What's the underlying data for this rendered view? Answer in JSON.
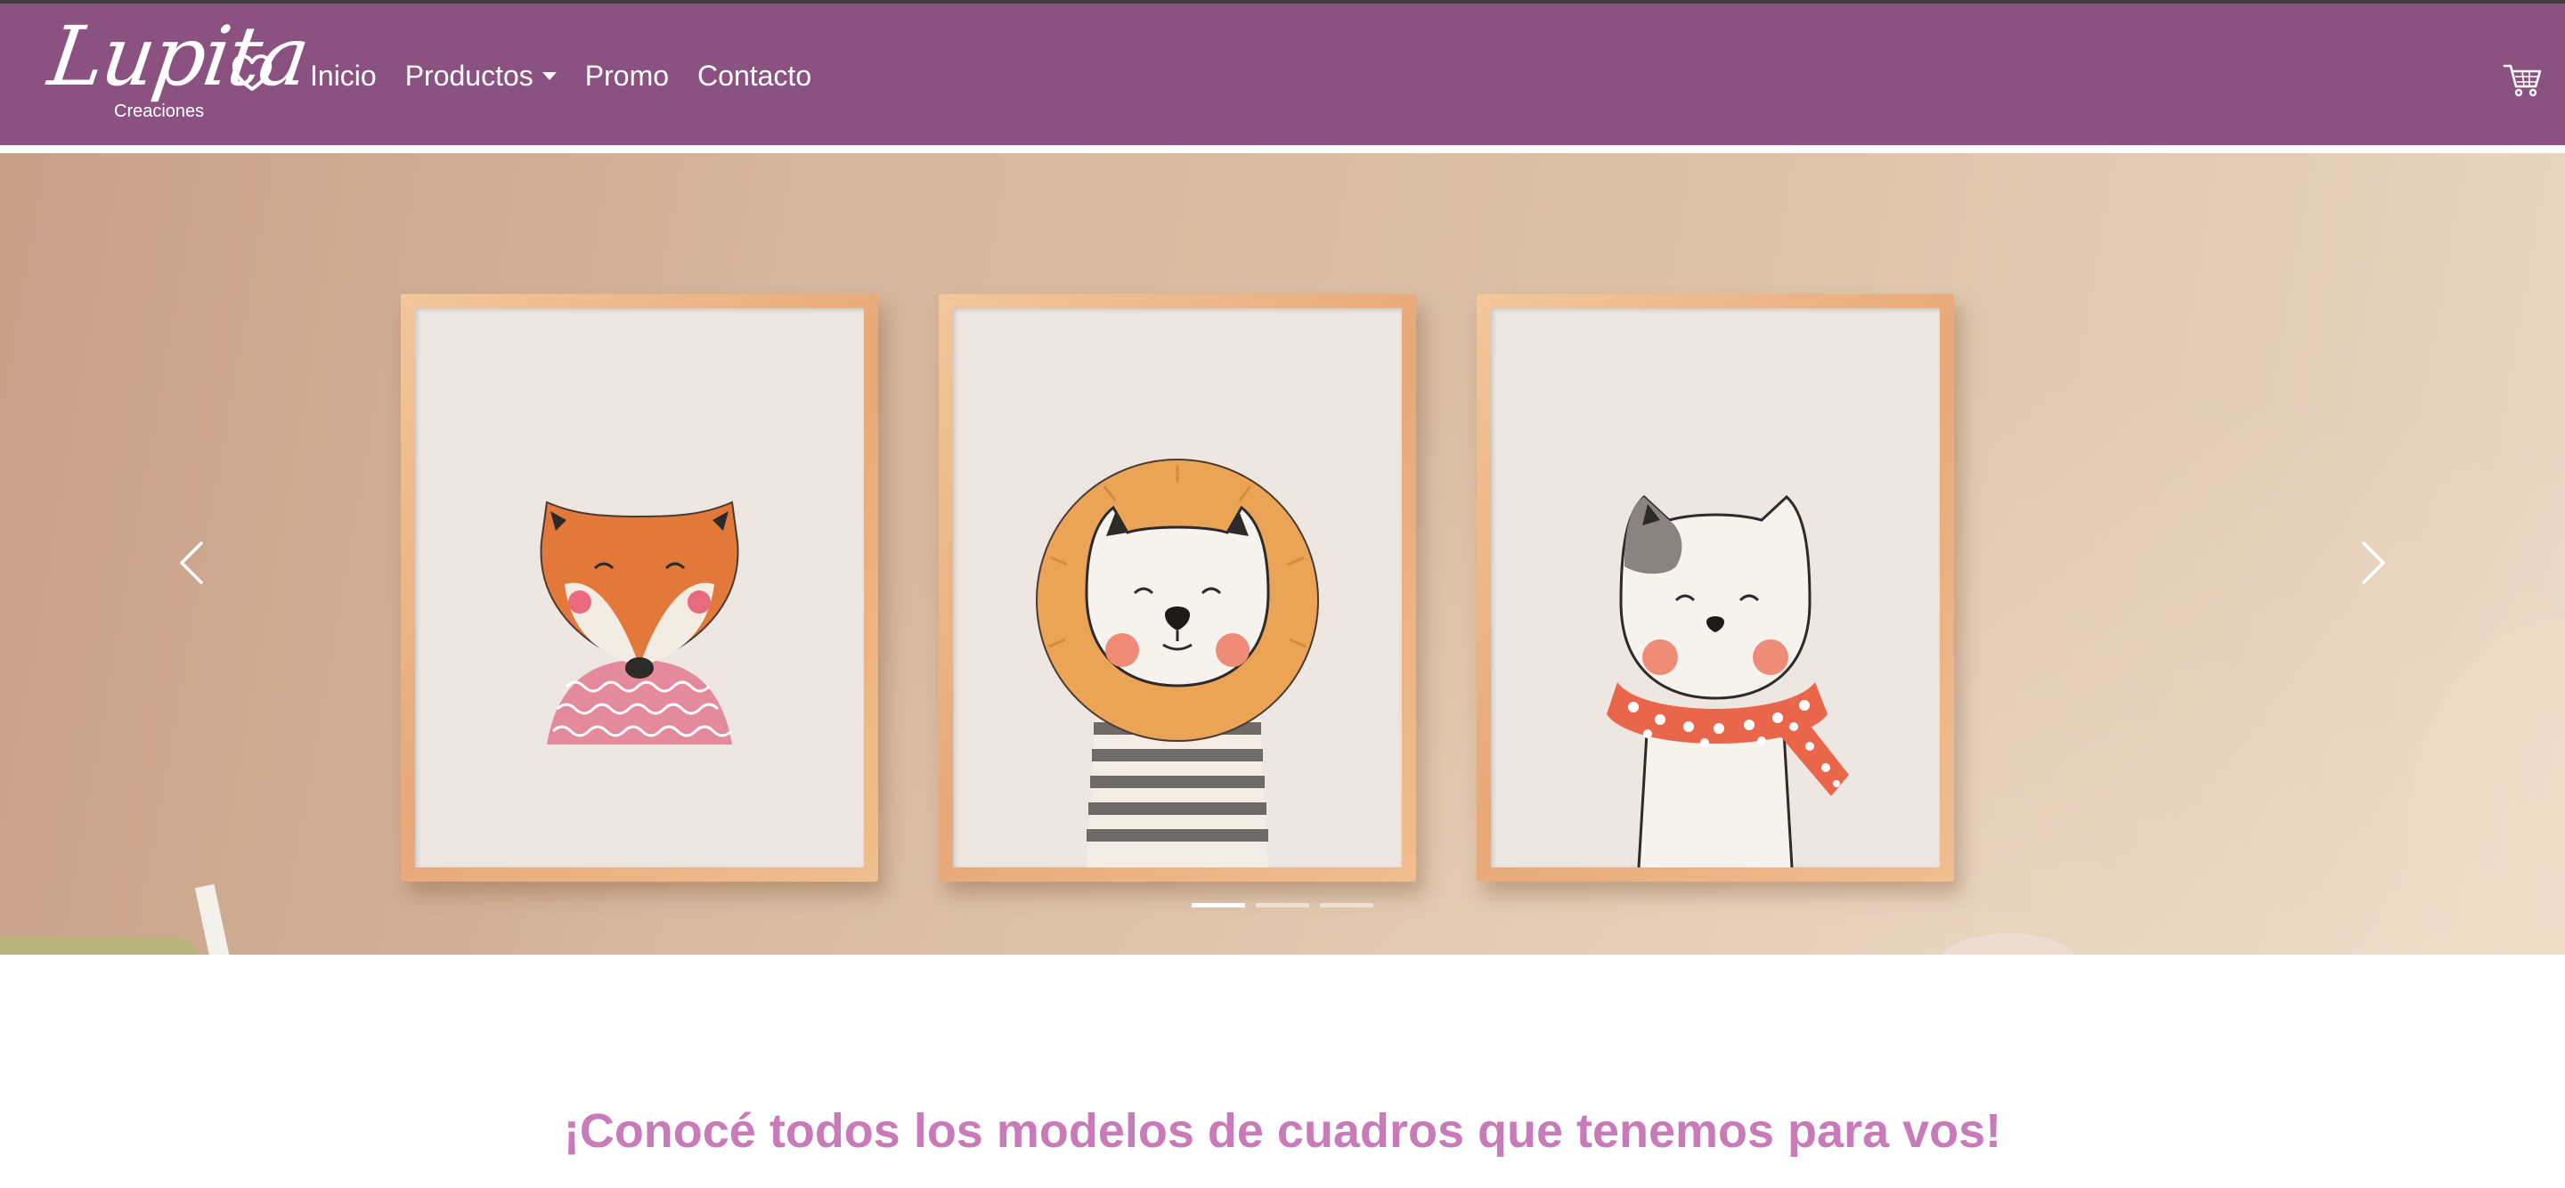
{
  "brand": {
    "name": "Lupita",
    "subtitle": "Creaciones"
  },
  "nav": {
    "items": [
      {
        "label": "Inicio"
      },
      {
        "label": "Productos",
        "has_dropdown": true
      },
      {
        "label": "Promo"
      },
      {
        "label": "Contacto"
      }
    ],
    "cart_icon": "cart-icon"
  },
  "carousel": {
    "slide_count": 3,
    "active_slide": 1,
    "prev_icon": "chevron-left-icon",
    "next_icon": "chevron-right-icon",
    "frames": [
      "fox-illustration",
      "lion-illustration",
      "cat-illustration"
    ]
  },
  "main": {
    "title": "¡Conocé todos los modelos de cuadros que tenemos para vos!"
  },
  "colors": {
    "navbar": "#8b5281",
    "title": "#c97ab8",
    "top_border": "#3d3d3d"
  }
}
